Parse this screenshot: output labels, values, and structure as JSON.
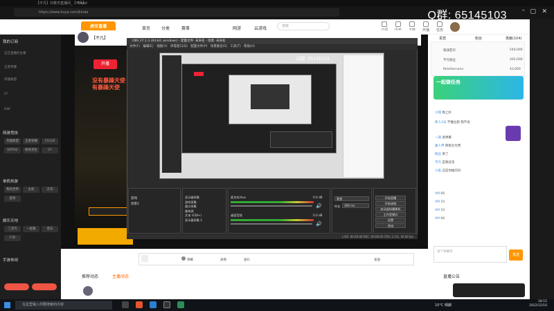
{
  "browser": {
    "tab_title": "【不凡】刘景杰直播间_【不凡】",
    "tab2": "Trend",
    "url": "https://www.huya.com/kinda"
  },
  "watermark": "Q群: 65145103",
  "header": {
    "logo": "虎牙直播",
    "nav": [
      "首页",
      "分类",
      "赛事",
      "网游",
      "云游戏"
    ],
    "search_placeholder": "搜索",
    "icons": [
      "订阅",
      "历史",
      "下载",
      "开播",
      "任务"
    ]
  },
  "sidebar": {
    "sections": [
      "我的订阅",
      "网游竞技",
      "单机热游",
      "娱乐天地",
      "手游休闲"
    ],
    "texts": [
      "正在直播的主播",
      "王者荣耀",
      "英雄联盟",
      "CF",
      "DNF",
      "和平精英"
    ],
    "buttons": [
      "英雄联盟",
      "王者荣耀",
      "CS:GO",
      "DOTA2",
      "绝地求生",
      "CF",
      "我的世界",
      "主机",
      "方舟",
      "星际",
      "二次元",
      "一起看",
      "音乐",
      "户外"
    ]
  },
  "video": {
    "streamer_name": "【不凡】",
    "red_button": "开播",
    "neon_text": "没有暴躁天使 没有暴躁天使"
  },
  "obs": {
    "title": "OBS 27.1.3 (64-bit, windows) - 配置文件: 未命名 - 场景: 未命名",
    "menu": [
      "文件(F)",
      "编辑(E)",
      "视图(V)",
      "停靠窗口(D)",
      "配置文件(P)",
      "场景集合(S)",
      "工具(T)",
      "帮助(H)"
    ],
    "preview_watermark": "Q群: 65145103",
    "panels": {
      "scenes": "场景",
      "sources": "来源",
      "mixer": "混音器",
      "transitions": "场景转场",
      "controls": "控制"
    },
    "scenes_list": [
      "游戏",
      "场景2"
    ],
    "sources_list": [
      "显示器采集",
      "游戏采集",
      "窗口采集",
      "媒体源",
      "文本 (GDI+)",
      "显示器采集 2"
    ],
    "mixer_tracks": [
      {
        "name": "麦克风/Aux",
        "db": "0.0 dB"
      },
      {
        "name": "桌面音频",
        "db": "0.0 dB"
      }
    ],
    "transition": {
      "type": "渐变",
      "duration_label": "时长",
      "duration": "300 ms"
    },
    "controls": [
      "开始直播",
      "开始录制",
      "启动虚拟摄像机",
      "工作室模式",
      "设置",
      "退出"
    ],
    "status": "LIVE: 00:00:00  REC: 00:00:00  CPU: 2.1%, 30.00 fps"
  },
  "chat_strip": {
    "items": [
      "弹幕",
      "表情",
      "送礼",
      "发送"
    ]
  },
  "below": {
    "tabs": [
      "推荐动态",
      "主播动态"
    ],
    "right_tab": "直播公告"
  },
  "chat": {
    "tabs": [
      "贵宾",
      "粉丝",
      "贡献(104)"
    ],
    "rank": [
      {
        "name": "铭涵若华",
        "value": "540,000"
      },
      {
        "name": "不凡粉丝",
        "value": "262,000"
      },
      {
        "name": "Reichlernann",
        "value": "43,000"
      }
    ],
    "banner": "一起做任务",
    "messages": [
      {
        "user": "小铭",
        "text": "晚上好"
      },
      {
        "user": "新人1号",
        "text": "不懂主题 我不会"
      },
      {
        "user": "一骑",
        "text": "发弹幕"
      },
      {
        "user": "路人甲",
        "text": "网易云付费"
      },
      {
        "user": "粉丝",
        "text": "来了"
      },
      {
        "user": "不凡",
        "text": "是我徒弟"
      },
      {
        "user": "小鱼",
        "text": "这是你推的吗"
      },
      {
        "user": "VM",
        "text": "66"
      },
      {
        "user": "VM",
        "text": "10"
      },
      {
        "user": "VM",
        "text": "10"
      },
      {
        "user": "VM",
        "text": "66"
      }
    ],
    "input_placeholder": "发个弹幕吧",
    "send": "发送"
  },
  "taskbar": {
    "search_placeholder": "在这里输入你要搜索的内容",
    "weather": "10°C 晴朗",
    "time": "18:15",
    "date": "2022/12/10"
  }
}
